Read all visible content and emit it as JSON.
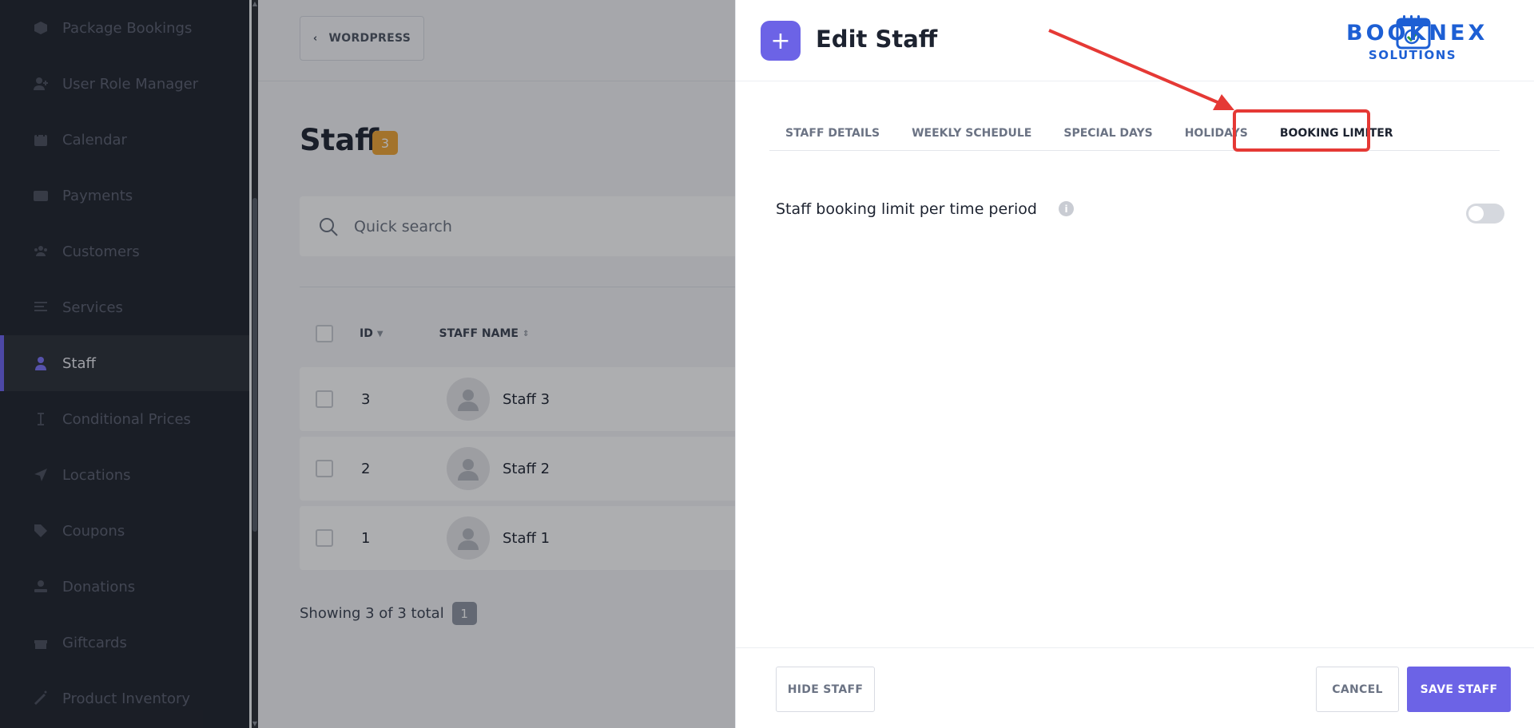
{
  "sidebar": {
    "items": [
      {
        "label": "Package Bookings",
        "icon": "box-icon"
      },
      {
        "label": "User Role Manager",
        "icon": "user-plus-icon"
      },
      {
        "label": "Calendar",
        "icon": "calendar-icon"
      },
      {
        "label": "Payments",
        "icon": "wallet-icon"
      },
      {
        "label": "Customers",
        "icon": "users-icon"
      },
      {
        "label": "Services",
        "icon": "list-icon"
      },
      {
        "label": "Staff",
        "icon": "user-icon",
        "active": true
      },
      {
        "label": "Conditional Prices",
        "icon": "i-beam-icon"
      },
      {
        "label": "Locations",
        "icon": "location-arrow-icon"
      },
      {
        "label": "Coupons",
        "icon": "tag-icon"
      },
      {
        "label": "Donations",
        "icon": "hand-heart-icon"
      },
      {
        "label": "Giftcards",
        "icon": "gift-icon"
      },
      {
        "label": "Product Inventory",
        "icon": "magic-wand-icon"
      }
    ]
  },
  "main": {
    "back_label": "WORDPRESS",
    "page_title": "Staff",
    "staff_count": "3",
    "search_placeholder": "Quick search",
    "columns": {
      "id": "ID",
      "staff_name": "STAFF NAME"
    },
    "rows": [
      {
        "id": "3",
        "name": "Staff 3"
      },
      {
        "id": "2",
        "name": "Staff 2"
      },
      {
        "id": "1",
        "name": "Staff 1"
      }
    ],
    "showing": "Showing 3 of 3 total",
    "page": "1"
  },
  "panel": {
    "title": "Edit Staff",
    "logo_top": "BOOKNEX",
    "logo_bottom": "SOLUTIONS",
    "tabs": [
      {
        "label": "STAFF DETAILS"
      },
      {
        "label": "WEEKLY SCHEDULE"
      },
      {
        "label": "SPECIAL DAYS"
      },
      {
        "label": "HOLIDAYS"
      },
      {
        "label": "BOOKING LIMITER",
        "active": true
      }
    ],
    "setting_label": "Staff booking limit per time period",
    "setting_enabled": false,
    "hide_label": "HIDE STAFF",
    "cancel_label": "CANCEL",
    "save_label": "SAVE STAFF"
  },
  "colors": {
    "accent": "#6c63e6",
    "badge": "#f0a534",
    "annotation": "#e53935",
    "sidebar_bg": "#1e222b"
  }
}
